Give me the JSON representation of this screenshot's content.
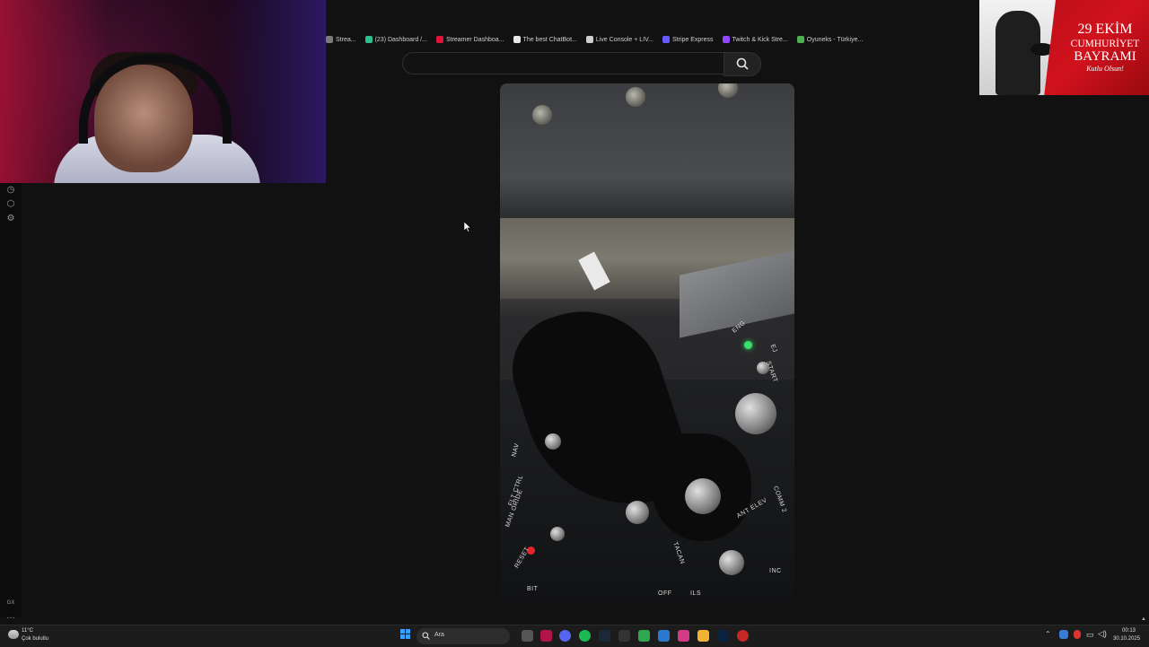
{
  "bookmarks": [
    {
      "label": "Strea...",
      "color": "#7a7a7a"
    },
    {
      "label": "(23) Dashboard /...",
      "color": "#2fbf8f"
    },
    {
      "label": "Streamer Dashboa...",
      "color": "#e0143b"
    },
    {
      "label": "The best ChatBot...",
      "color": "#e8e8e8"
    },
    {
      "label": "Live Console + LIV...",
      "color": "#cfcfcf"
    },
    {
      "label": "Stripe Express",
      "color": "#635bff"
    },
    {
      "label": "Twitch & Kick Stre...",
      "color": "#9147ff"
    },
    {
      "label": "Oyuneks - Türkiye...",
      "color": "#4caf50"
    }
  ],
  "search": {
    "placeholder": "",
    "value": ""
  },
  "video": {
    "panel_labels": [
      "NAV",
      "FLT CTRL",
      "MAN ORIDE",
      "ANT ELEV",
      "OFF",
      "BIT",
      "RESET",
      "INC",
      "ILS",
      "COMM 2",
      "TACAN",
      "START",
      "EJ",
      "ENG"
    ]
  },
  "banner": {
    "line1": "29 EKİM",
    "line2": "CUMHURİYET",
    "line3": "BAYRAMI",
    "signature": "Kutlu Olsun!"
  },
  "sidebar_bottom": {
    "label": "GX"
  },
  "taskbar": {
    "weather_temp": "11°C",
    "weather_desc": "Çok bulutlu",
    "search_placeholder": "Ara",
    "time": "00:13",
    "date": "30.10.2025"
  },
  "colors": {
    "background": "#111111",
    "banner_red": "#d1121d",
    "led_green": "#39e06a",
    "led_red": "#e3262b"
  }
}
